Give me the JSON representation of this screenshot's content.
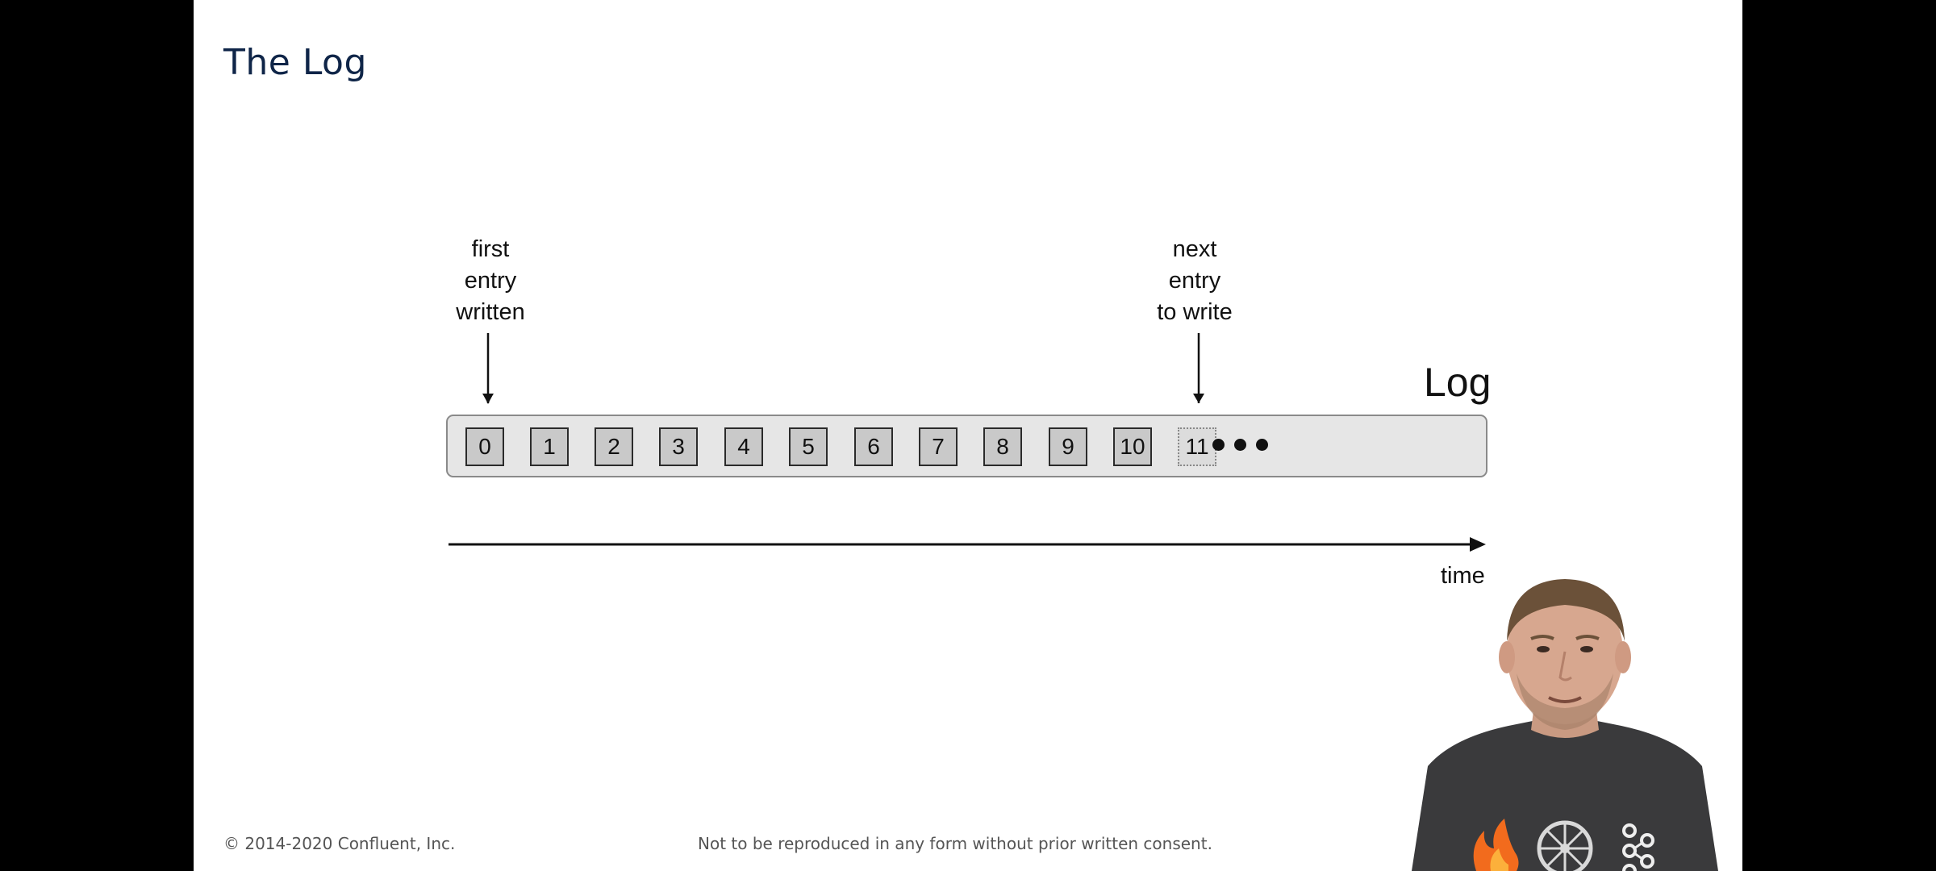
{
  "slide": {
    "title": "The Log"
  },
  "diagram": {
    "first_pointer": [
      "first",
      "entry",
      "written"
    ],
    "next_pointer": [
      "next",
      "entry",
      "to write"
    ],
    "log_label": "Log",
    "entries": [
      "0",
      "1",
      "2",
      "3",
      "4",
      "5",
      "6",
      "7",
      "8",
      "9",
      "10"
    ],
    "pending_entry": "11",
    "axis_label": "time"
  },
  "footer": {
    "copyright": "© 2014-2020 Confluent, Inc.",
    "notice": "Not to be reproduced in any form without prior written consent."
  },
  "colors": {
    "title": "#0f2548",
    "log_bar_fill": "#e6e6e6",
    "entry_fill": "#c9c9c9",
    "pending_fill": "#dcdcdc",
    "letterbox": "#000000"
  },
  "presenter_shirt_icons": [
    "flame-icon",
    "wheel-icon",
    "kafka-icon"
  ]
}
